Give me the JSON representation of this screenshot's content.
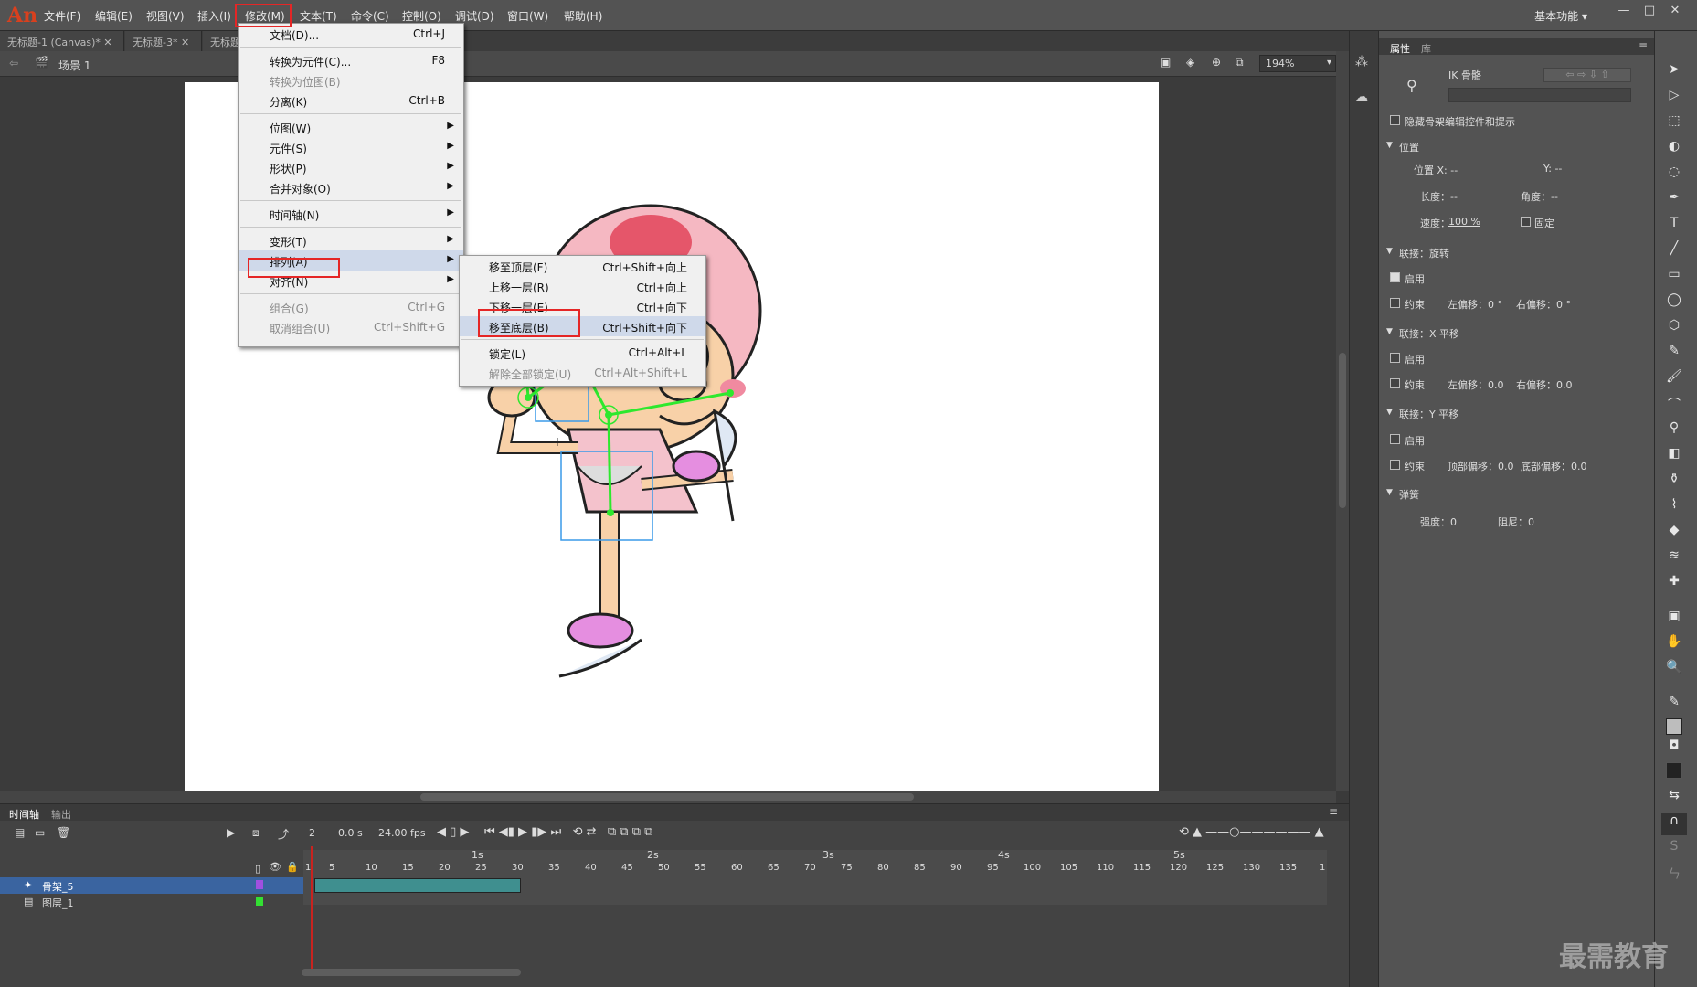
{
  "app": {
    "logo": "An",
    "workspace": "基本功能 ▾"
  },
  "menubar": [
    "文件(F)",
    "编辑(E)",
    "视图(V)",
    "插入(I)",
    "修改(M)",
    "文本(T)",
    "命令(C)",
    "控制(O)",
    "调试(D)",
    "窗口(W)",
    "帮助(H)"
  ],
  "tabs": [
    "无标题-1 (Canvas)*",
    "无标题-3*",
    "无标题"
  ],
  "scene": {
    "label": "场景 1",
    "zoom": "194%"
  },
  "modify_menu": [
    {
      "label": "文档(D)...",
      "shortcut": "Ctrl+J"
    },
    {
      "sep": true
    },
    {
      "label": "转换为元件(C)...",
      "shortcut": "F8"
    },
    {
      "label": "转换为位图(B)",
      "shortcut": "",
      "disabled": true
    },
    {
      "label": "分离(K)",
      "shortcut": "Ctrl+B"
    },
    {
      "sep": true
    },
    {
      "label": "位图(W)",
      "arrow": true
    },
    {
      "label": "元件(S)",
      "arrow": true
    },
    {
      "label": "形状(P)",
      "arrow": true
    },
    {
      "label": "合并对象(O)",
      "arrow": true
    },
    {
      "sep": true
    },
    {
      "label": "时间轴(N)",
      "arrow": true
    },
    {
      "sep": true
    },
    {
      "label": "变形(T)",
      "arrow": true
    },
    {
      "label": "排列(A)",
      "arrow": true,
      "active": true
    },
    {
      "label": "对齐(N)",
      "arrow": true
    },
    {
      "sep": true
    },
    {
      "label": "组合(G)",
      "shortcut": "Ctrl+G",
      "disabled": true
    },
    {
      "label": "取消组合(U)",
      "shortcut": "Ctrl+Shift+G",
      "disabled": true
    }
  ],
  "arrange_menu": [
    {
      "label": "移至顶层(F)",
      "shortcut": "Ctrl+Shift+向上"
    },
    {
      "label": "上移一层(R)",
      "shortcut": "Ctrl+向上"
    },
    {
      "label": "下移一层(E)",
      "shortcut": "Ctrl+向下"
    },
    {
      "label": "移至底层(B)",
      "shortcut": "Ctrl+Shift+向下",
      "active": true
    },
    {
      "sep": true
    },
    {
      "label": "锁定(L)",
      "shortcut": "Ctrl+Alt+L"
    },
    {
      "label": "解除全部锁定(U)",
      "shortcut": "Ctrl+Alt+Shift+L",
      "disabled": true
    }
  ],
  "properties": {
    "tabs": [
      "属性",
      "库"
    ],
    "ik_label": "IK 骨骼",
    "hide_bone": "隐藏骨架编辑控件和提示",
    "position_header": "位置",
    "pos_x": "位置  X: --",
    "pos_y": "Y: --",
    "length": "长度：--",
    "angle": "角度：--",
    "speed_label": "速度：",
    "speed_value": "100 %",
    "fixed": "固定",
    "joint_rot": "联接：旋转",
    "enable1": "启用",
    "constrain1": "约束",
    "left_off1": "左偏移：0 °",
    "right_off1": "右偏移：0 °",
    "joint_x": "联接：X 平移",
    "enable2": "启用",
    "constrain2": "约束",
    "left_off2": "左偏移：0.0",
    "right_off2": "右偏移：0.0",
    "joint_y": "联接：Y 平移",
    "enable3": "启用",
    "constrain3": "约束",
    "top_off": "顶部偏移：0.0",
    "bottom_off": "底部偏移：0.0",
    "spring": "弹簧",
    "strength": "强度：0",
    "damping": "阻尼：0"
  },
  "timeline": {
    "tabs": [
      "时间轴",
      "输出"
    ],
    "frame": "2",
    "time": "0.0 s",
    "fps": "24.00 fps",
    "seconds": [
      "1s",
      "2s",
      "3s",
      "4s",
      "5s"
    ],
    "frames": [
      "1",
      "5",
      "10",
      "15",
      "20",
      "25",
      "30",
      "35",
      "40",
      "45",
      "50",
      "55",
      "60",
      "65",
      "70",
      "75",
      "80",
      "85",
      "90",
      "95",
      "100",
      "105",
      "110",
      "115",
      "120",
      "125",
      "130",
      "135",
      "1"
    ],
    "layers": [
      {
        "name": "骨架_5"
      },
      {
        "name": "图层_1"
      }
    ]
  },
  "watermark": "最需教育"
}
